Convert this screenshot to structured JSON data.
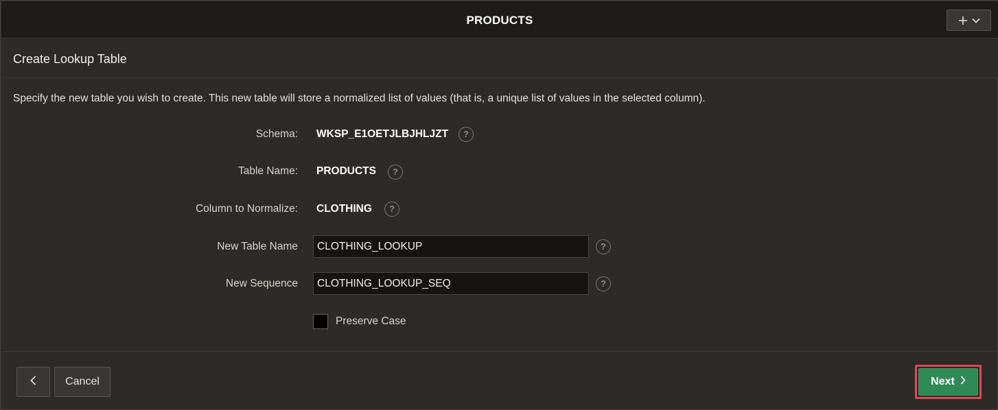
{
  "dialog": {
    "title": "PRODUCTS"
  },
  "subheader": {
    "title": "Create Lookup Table"
  },
  "description": "Specify the new table you wish to create. This new table will store a normalized list of values (that is, a unique list of values in the selected column).",
  "form": {
    "schema": {
      "label": "Schema:",
      "value": "WKSP_E1OETJLBJHLJZT"
    },
    "table_name": {
      "label": "Table Name:",
      "value": "PRODUCTS"
    },
    "column_to_normalize": {
      "label": "Column to Normalize:",
      "value": "CLOTHING"
    },
    "new_table_name": {
      "label": "New Table Name",
      "value": "CLOTHING_LOOKUP"
    },
    "new_sequence": {
      "label": "New Sequence",
      "value": "CLOTHING_LOOKUP_SEQ"
    },
    "preserve_case": {
      "label": "Preserve Case",
      "checked": false
    }
  },
  "help_glyph": "?",
  "footer": {
    "cancel_label": "Cancel",
    "next_label": "Next"
  },
  "icons": {
    "add": "plus-icon",
    "menu": "chevron-down-icon",
    "previous": "chevron-left-icon",
    "next": "chevron-right-icon",
    "help": "help-icon"
  },
  "colors": {
    "background": "#2e2a27",
    "titlebar": "#1e1c1a",
    "primary_button": "#2f8a56",
    "highlight": "#e0484f"
  }
}
